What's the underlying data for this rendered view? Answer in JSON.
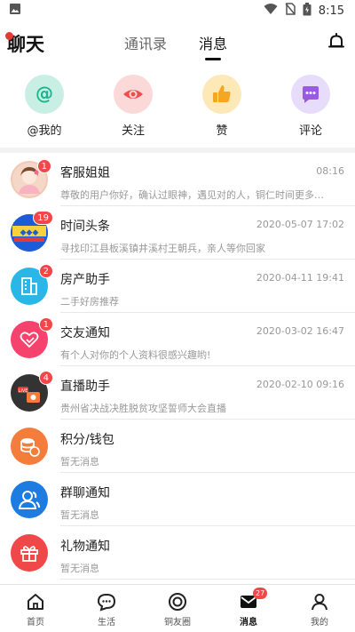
{
  "status_bar": {
    "time": "8:15"
  },
  "header": {
    "title": "聊天",
    "tabs": [
      {
        "label": "通讯录",
        "active": false
      },
      {
        "label": "消息",
        "active": true
      }
    ]
  },
  "quick_actions": [
    {
      "label": "@我的",
      "icon": "at-icon",
      "bg": "#c9efe5",
      "fg": "#1bb58f"
    },
    {
      "label": "关注",
      "icon": "eye-icon",
      "bg": "#fbd9d9",
      "fg": "#ef4f4f"
    },
    {
      "label": "赞",
      "icon": "thumbs-up-icon",
      "bg": "#fde8b8",
      "fg": "#f5a623"
    },
    {
      "label": "评论",
      "icon": "comment-icon",
      "bg": "#e8dcfb",
      "fg": "#9b59e8"
    }
  ],
  "messages": [
    {
      "title": "客服姐姐",
      "subtitle": "尊敬的用户你好，确认过眼神，遇见对的人，铜仁时间更多…",
      "time": "08:16",
      "badge": "1",
      "avatar_color": "#f5d7c8"
    },
    {
      "title": "时间头条",
      "subtitle": "寻找印江县板溪镇井溪村王朝兵，亲人等你回家",
      "time": "2020-05-07 17:02",
      "badge": "19",
      "avatar_color": "#1e5bd6"
    },
    {
      "title": "房产助手",
      "subtitle": "二手好房推荐",
      "time": "2020-04-11 19:41",
      "badge": "2",
      "avatar_color": "#2bb6e8"
    },
    {
      "title": "交友通知",
      "subtitle": "有个人对你的个人资料很感兴趣哟!",
      "time": "2020-03-02 16:47",
      "badge": "1",
      "avatar_color": "#f5436e"
    },
    {
      "title": "直播助手",
      "subtitle": "贵州省决战决胜脱贫攻坚誓师大会直播",
      "time": "2020-02-10 09:16",
      "badge": "4",
      "avatar_color": "#333333"
    },
    {
      "title": "积分/钱包",
      "subtitle": "暂无消息",
      "time": "",
      "badge": "",
      "avatar_color": "#f57d3c"
    },
    {
      "title": "群聊通知",
      "subtitle": "暂无消息",
      "time": "",
      "badge": "",
      "avatar_color": "#1e7be0"
    },
    {
      "title": "礼物通知",
      "subtitle": "暂无消息",
      "time": "",
      "badge": "",
      "avatar_color": "#f04848"
    }
  ],
  "tab_bar": [
    {
      "label": "首页",
      "icon": "home-icon",
      "active": false,
      "badge": ""
    },
    {
      "label": "生活",
      "icon": "chat-bubble-icon",
      "active": false,
      "badge": ""
    },
    {
      "label": "铜友圈",
      "icon": "circle-target-icon",
      "active": false,
      "badge": ""
    },
    {
      "label": "消息",
      "icon": "mail-icon",
      "active": true,
      "badge": "27"
    },
    {
      "label": "我的",
      "icon": "person-icon",
      "active": false,
      "badge": ""
    }
  ]
}
